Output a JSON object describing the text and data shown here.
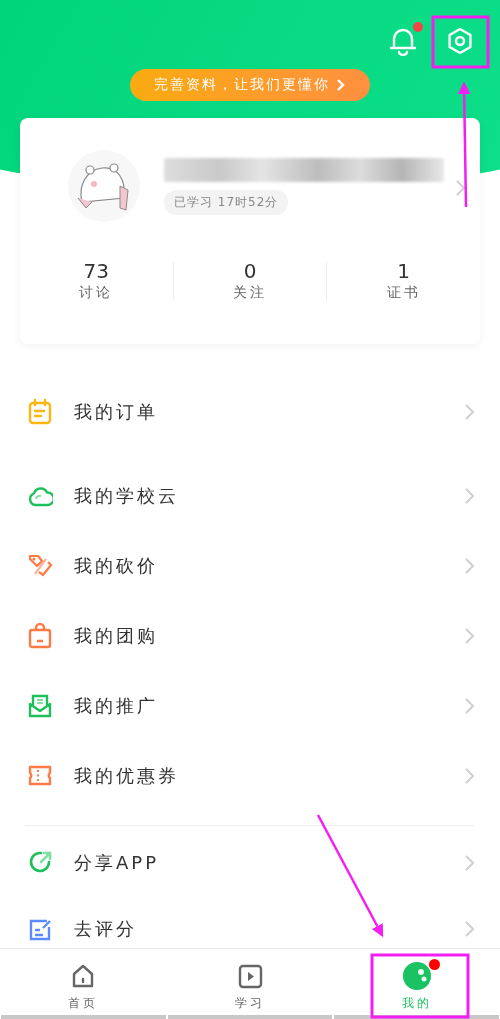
{
  "header": {
    "notification_dot": true,
    "banner": "完善资料，让我们更懂你"
  },
  "profile": {
    "study_time": "已学习 17时52分",
    "stats": [
      {
        "value": "73",
        "label": "讨论"
      },
      {
        "value": "0",
        "label": "关注"
      },
      {
        "value": "1",
        "label": "证书"
      }
    ]
  },
  "menu_sections": [
    [
      {
        "label": "我的订单"
      }
    ],
    [
      {
        "label": "我的学校云"
      },
      {
        "label": "我的砍价"
      },
      {
        "label": "我的团购"
      },
      {
        "label": "我的推广"
      },
      {
        "label": "我的优惠券"
      }
    ],
    [
      {
        "label": "分享APP"
      },
      {
        "label": "去评分"
      }
    ]
  ],
  "tab_bar": [
    {
      "label": "首页",
      "selected": false,
      "badge": false
    },
    {
      "label": "学习",
      "selected": false,
      "badge": false
    },
    {
      "label": "我的",
      "selected": true,
      "badge": true
    }
  ]
}
